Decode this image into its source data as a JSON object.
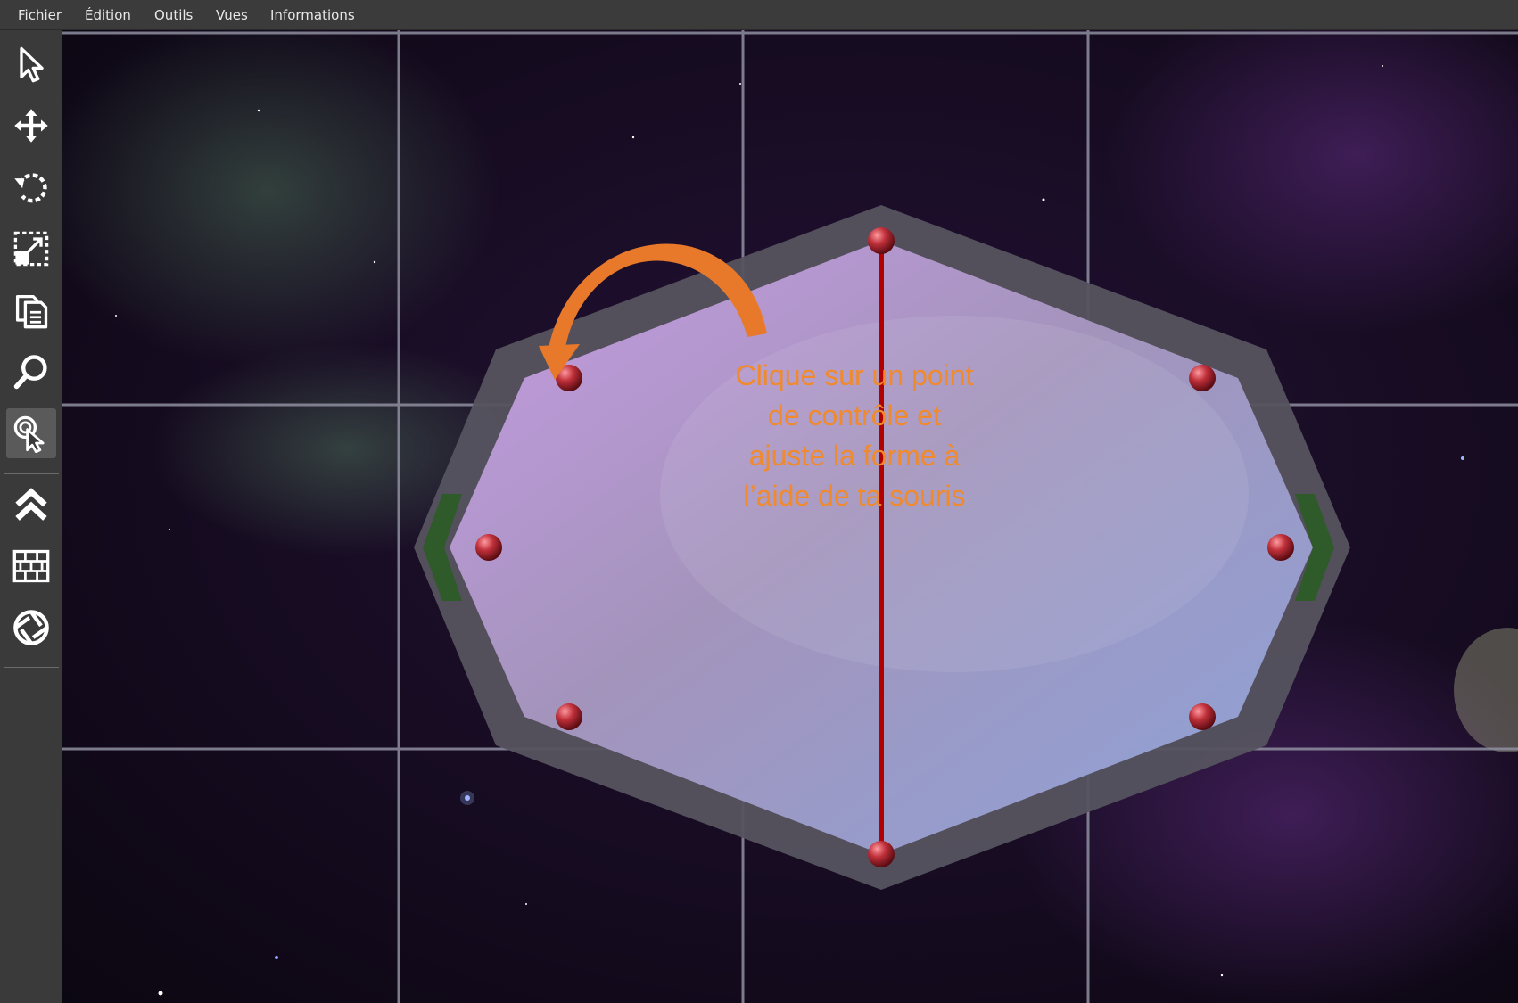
{
  "menu": {
    "items": [
      "Fichier",
      "Édition",
      "Outils",
      "Vues",
      "Informations"
    ]
  },
  "toolbar": {
    "tools": [
      {
        "icon": "select-arrow-icon"
      },
      {
        "icon": "move-icon"
      },
      {
        "icon": "rotate-icon"
      },
      {
        "icon": "scale-icon"
      },
      {
        "icon": "copy-icon"
      },
      {
        "icon": "zoom-icon"
      },
      {
        "icon": "edit-points-icon",
        "active": true
      },
      {
        "icon": "chevrons-up-icon"
      },
      {
        "icon": "brick-wall-icon"
      },
      {
        "icon": "aperture-icon"
      }
    ]
  },
  "canvas": {
    "hint_lines": [
      "Clique sur un point",
      "de contrôle et",
      "ajuste la forme à",
      "l’aide de ta souris"
    ],
    "colors": {
      "hint": "#f08a2c",
      "control_point": "#c0303a",
      "axis_line": "#b00000",
      "frame": "#55535f",
      "guide_tab": "#2f5a2a",
      "grid": "#8f8fa0"
    }
  }
}
